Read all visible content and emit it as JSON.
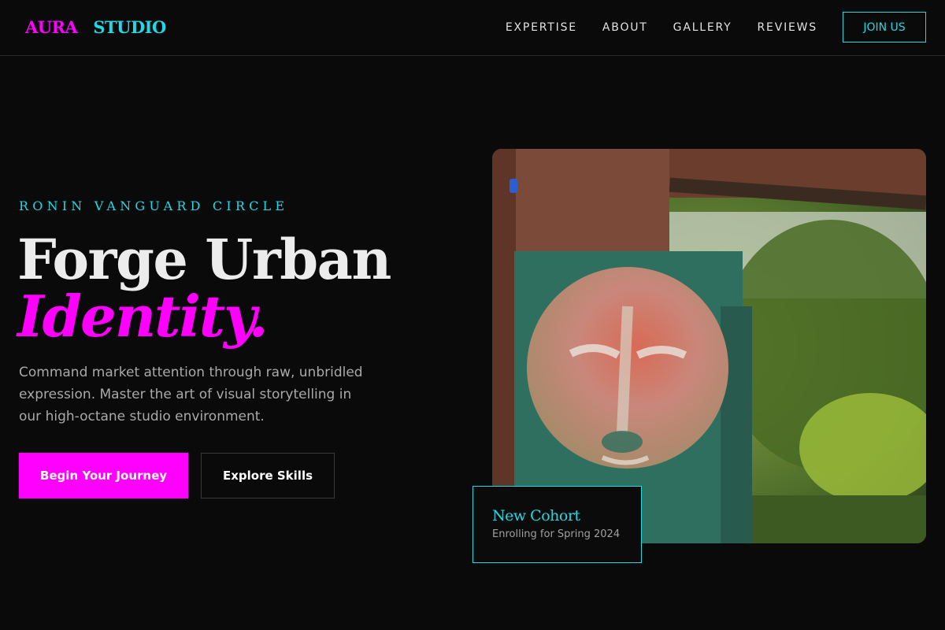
{
  "header": {
    "brand_part1": "AURA",
    "brand_part2": "STUDIO",
    "nav": [
      "EXPERTISE",
      "ABOUT",
      "GALLERY",
      "REVIEWS"
    ],
    "cta": "JOIN US"
  },
  "hero": {
    "eyebrow": "RONIN VANGUARD CIRCLE",
    "headline_line1": "Forge Urban",
    "headline_line2": "Identity.",
    "description": "Command market attention through raw, unbridled expression. Master the art of visual storytelling in our high-octane studio environment.",
    "primary_button": "Begin Your Journey",
    "secondary_button": "Explore Skills",
    "image": "painted-face-mural-photo"
  },
  "cohort_card": {
    "title": "New Cohort",
    "subtitle": "Enrolling for Spring 2024"
  },
  "colors": {
    "background": "#0a0a0a",
    "accent_magenta": "#ff00ff",
    "accent_cyan": "#22d8e4",
    "text_primary": "#ececec",
    "text_muted": "#a9a9a9"
  }
}
